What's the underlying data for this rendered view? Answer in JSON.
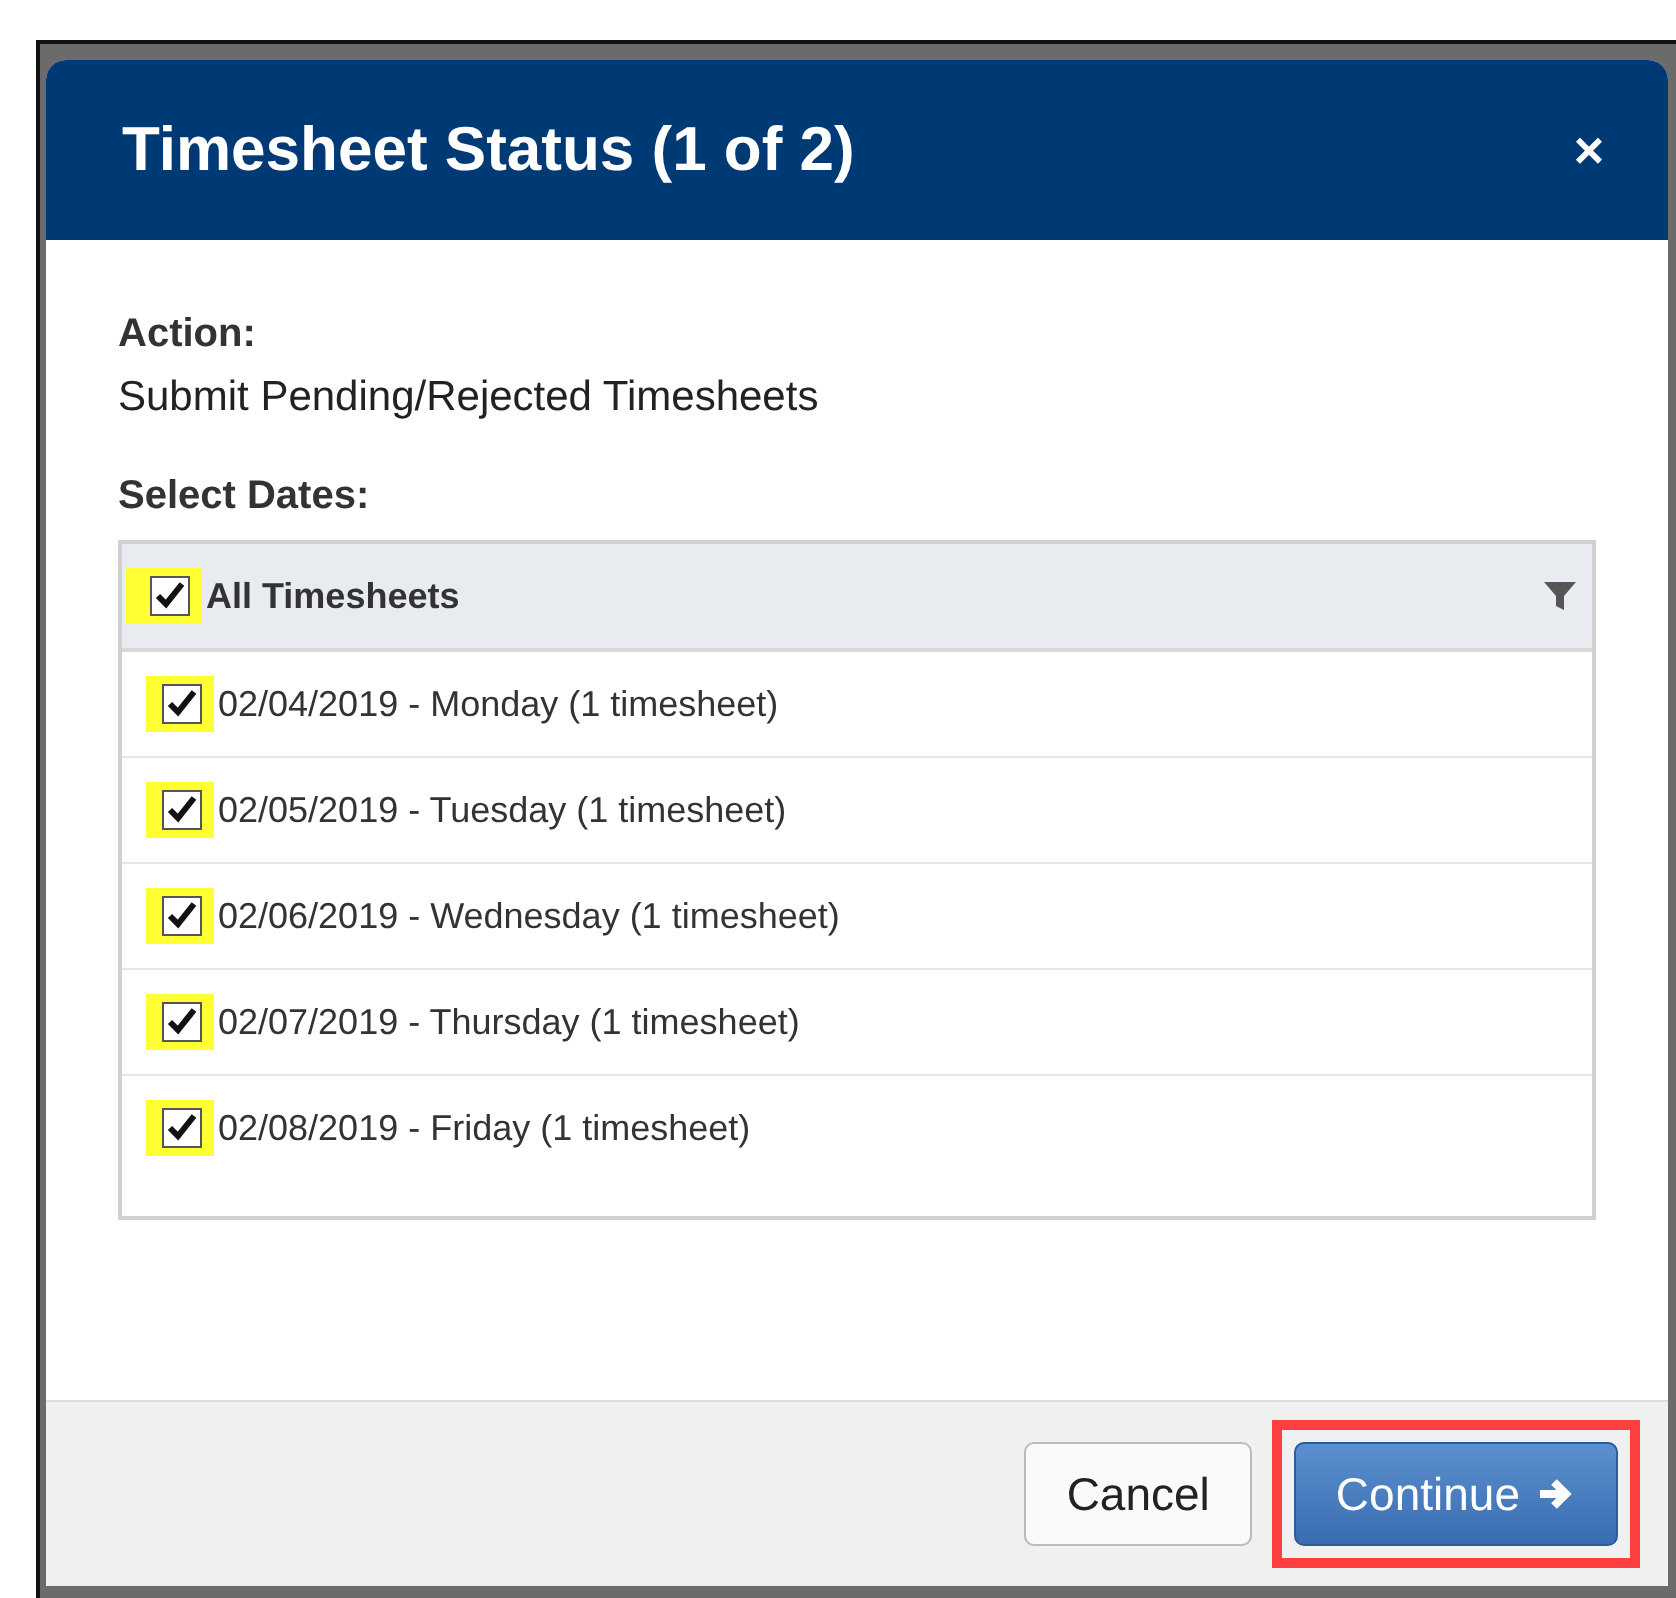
{
  "dialog": {
    "title": "Timesheet Status (1 of 2)",
    "close": "×"
  },
  "action": {
    "label": "Action:",
    "value": "Submit Pending/Rejected Timesheets"
  },
  "dates": {
    "label": "Select Dates:",
    "header": {
      "label": "All Timesheets",
      "checked": true
    },
    "rows": [
      {
        "label": "02/04/2019 - Monday (1 timesheet)",
        "checked": true
      },
      {
        "label": "02/05/2019 - Tuesday (1 timesheet)",
        "checked": true
      },
      {
        "label": "02/06/2019 - Wednesday (1 timesheet)",
        "checked": true
      },
      {
        "label": "02/07/2019 - Thursday (1 timesheet)",
        "checked": true
      },
      {
        "label": "02/08/2019 - Friday (1 timesheet)",
        "checked": true
      }
    ]
  },
  "buttons": [
    {
      "kind": "secondary",
      "label": "Cancel"
    },
    {
      "kind": "primary",
      "label": "Continue"
    }
  ]
}
